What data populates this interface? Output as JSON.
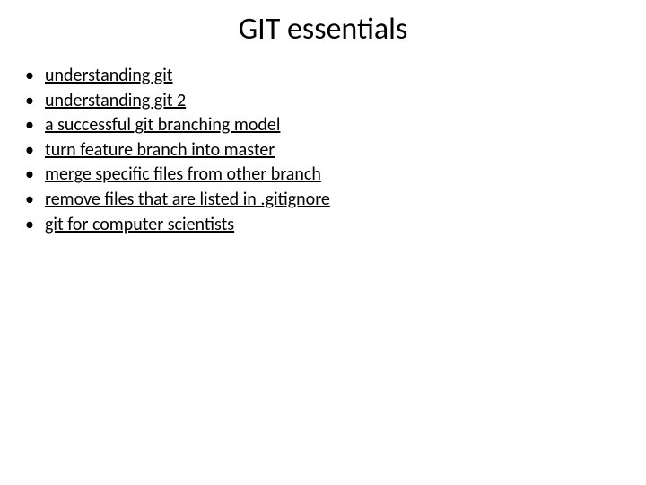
{
  "title": "GIT essentials",
  "items": [
    {
      "label": "understanding git"
    },
    {
      "label": "understanding git 2"
    },
    {
      "label": "a successful git branching model"
    },
    {
      "label": "turn feature branch into master"
    },
    {
      "label": "merge specific files from other branch"
    },
    {
      "label": "remove files that are listed in .gitignore"
    },
    {
      "label": "git for computer scientists"
    }
  ]
}
